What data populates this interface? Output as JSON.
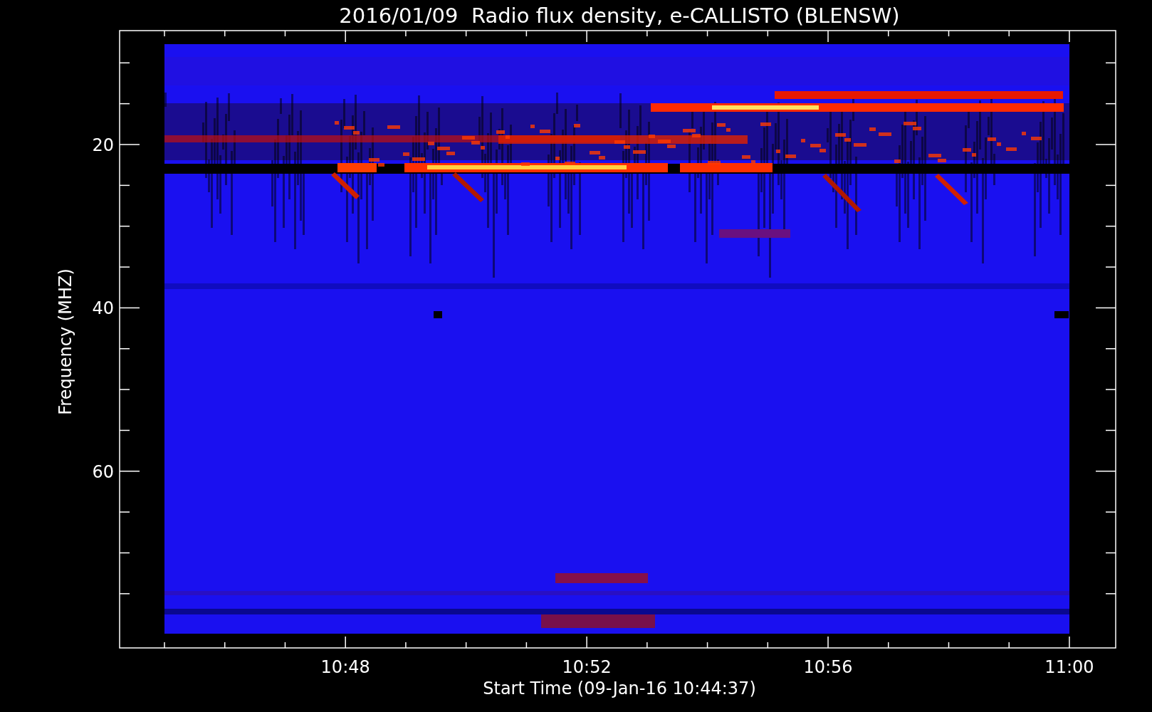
{
  "title": "2016/01/09  Radio flux density, e-CALLISTO (BLENSW)",
  "y_axis": {
    "label": "Frequency (MHZ)",
    "ticks": [
      "20",
      "40",
      "60"
    ]
  },
  "x_axis": {
    "label": "Start Time (09-Jan-16 10:44:37)",
    "ticks": [
      "10:48",
      "10:52",
      "10:56",
      "11:00"
    ]
  }
}
